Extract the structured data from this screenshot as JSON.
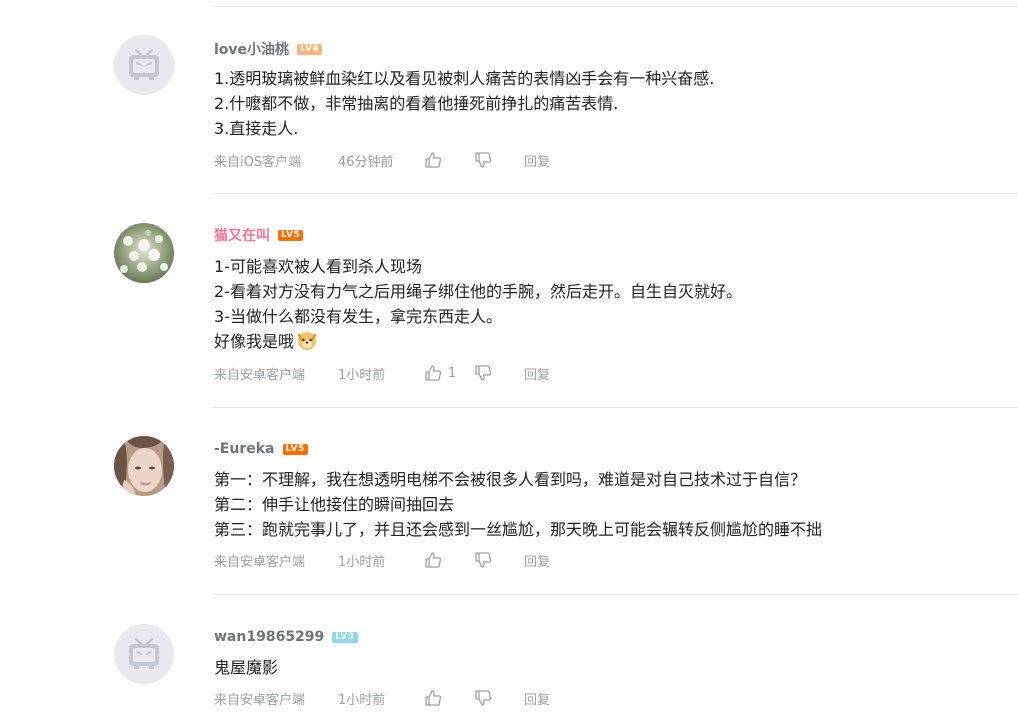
{
  "comments": [
    {
      "username": "love小油桃",
      "level": "LV4",
      "avatar": "bilibili-tv-default-avatar",
      "lines": [
        "1.透明玻璃被鲜血染红以及看见被刺人痛苦的表情凶手会有一种兴奋感.",
        "2.什嚒都不做，非常抽离的看着他捶死前挣扎的痛苦表情.",
        "3.直接走人."
      ],
      "source": "来自iOS客户端",
      "time": "46分钟前",
      "likes": "",
      "reply_label": "回复"
    },
    {
      "username": "猫又在叫",
      "level": "LV5",
      "avatar": "flowers-photo-avatar",
      "lines": [
        "1-可能喜欢被人看到杀人现场",
        "2-看着对方没有力气之后用绳子绑住他的手腕，然后走开。自生自灭就好。",
        "3-当做什么都没有发生，拿完东西走人。",
        "好像我是哦"
      ],
      "source": "来自安卓客户端",
      "time": "1小时前",
      "likes": "1",
      "reply_label": "回复"
    },
    {
      "username": "-Eureka",
      "level": "LV5",
      "avatar": "girl-photo-avatar",
      "lines": [
        "第一：不理解，我在想透明电梯不会被很多人看到吗，难道是对自己技术过于自信？",
        "第二：伸手让他接住的瞬间抽回去",
        "第三：跑就完事儿了，并且还会感到一丝尴尬，那天晚上可能会辗转反侧尴尬的睡不拙"
      ],
      "source": "来自安卓客户端",
      "time": "1小时前",
      "likes": "",
      "reply_label": "回复"
    },
    {
      "username": "wan19865299",
      "level": "LV3",
      "avatar": "bilibili-tv-default-avatar",
      "lines": [
        "鬼屋魔影"
      ],
      "source": "来自安卓客户端",
      "time": "1小时前",
      "likes": "",
      "reply_label": "回复"
    }
  ],
  "colors": {
    "username": "#6d757a",
    "vip_username": "#fb7299",
    "meta": "#99a2aa",
    "divider": "#e5e9ef",
    "lv3": "#8ed8ec",
    "lv4": "#ffb37c",
    "lv5": "#ff6c00"
  },
  "icons": {
    "like": "thumbs-up-icon",
    "dislike": "thumbs-down-icon",
    "emoji": "doge-emoji"
  }
}
